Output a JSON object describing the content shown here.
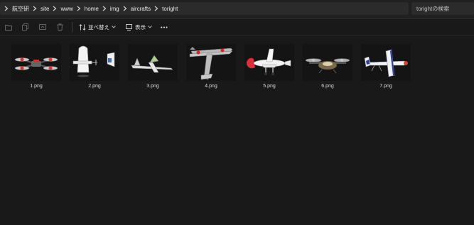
{
  "breadcrumb": [
    "航空研",
    "site",
    "www",
    "home",
    "img",
    "aircrafts",
    "toright"
  ],
  "search": {
    "placeholder": "torightの検索"
  },
  "toolbar": {
    "sort_label": "並べ替え",
    "view_label": "表示",
    "more_label": "•••"
  },
  "icons": [
    "chevron-right-icon",
    "new-folder-icon",
    "copy-icon",
    "share-icon",
    "delete-icon",
    "sort-icon",
    "view-icon",
    "more-icon"
  ],
  "files": [
    {
      "name": "1.png",
      "aircraft": "drone"
    },
    {
      "name": "2.png",
      "aircraft": "white-plane-front"
    },
    {
      "name": "3.png",
      "aircraft": "glider"
    },
    {
      "name": "4.png",
      "aircraft": "zero-fighter"
    },
    {
      "name": "5.png",
      "aircraft": "red-nose-plane"
    },
    {
      "name": "6.png",
      "aircraft": "drone-2"
    },
    {
      "name": "7.png",
      "aircraft": "aerobatic-plane"
    }
  ]
}
